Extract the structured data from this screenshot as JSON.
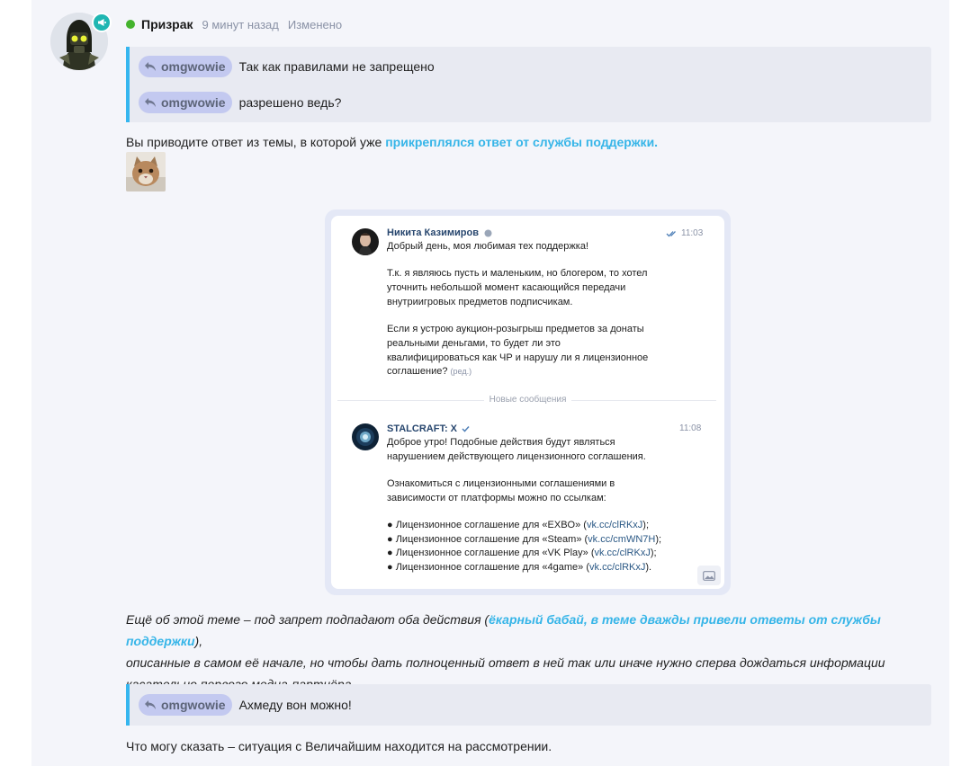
{
  "post": {
    "author": "Призрак",
    "time": "9 минут назад",
    "edited": "Изменено"
  },
  "quotes": [
    {
      "user": "omgwowie",
      "text": "Так как правилами не запрещено"
    },
    {
      "user": "omgwowie",
      "text": "разрешено ведь?"
    },
    {
      "user": "omgwowie",
      "text": "Ахмеду вон можно!"
    }
  ],
  "para1": {
    "before": "Вы приводите ответ из темы, в которой уже ",
    "link": "прикреплялся ответ от службы поддержки."
  },
  "screenshot": {
    "msg1": {
      "name": "Никита Казимиров",
      "time": "11:03",
      "lines": [
        "Добрый день, моя любимая тех поддержка!",
        "Т.к. я являюсь пусть и маленьким, но блогером, то хотел",
        "уточнить небольшой момент касающийся передачи",
        "внутриигровых предметов подписчикам.",
        "Если я устрою аукцион-розыгрыш предметов за донаты",
        "реальными деньгами, то будет ли это",
        "квалифицироваться как ЧР и нарушу ли я лицензионное",
        "соглашение?"
      ],
      "edited_mark": "(ред.)"
    },
    "divider": "Новые сообщения",
    "msg2": {
      "name": "STALCRAFT: X",
      "time": "11:08",
      "lines": [
        "Доброе утро! Подобные действия будут являться",
        "нарушением действующего лицензионного соглашения.",
        "Ознакомиться с лицензионными соглашениями в",
        "зависимости от платформы можно по ссылкам:"
      ],
      "bullets": [
        {
          "text": "● Лицензионное соглашение для «EXBO» (",
          "link": "vk.cc/clRKxJ",
          "end": ");"
        },
        {
          "text": "● Лицензионное соглашение для «Steam» (",
          "link": "vk.cc/cmWN7H",
          "end": ");"
        },
        {
          "text": "● Лицензионное соглашение для «VK Play» (",
          "link": "vk.cc/clRKxJ",
          "end": ");"
        },
        {
          "text": "● Лицензионное соглашение для «4game» (",
          "link": "vk.cc/clRKxJ",
          "end": ")."
        }
      ]
    }
  },
  "para2": {
    "before": "Ещё об этой теме – под запрет подпадают оба действия (",
    "link": "ёкарный бабай, в теме дважды привели ответы от службы поддержки",
    "after": "),",
    "line2": "описанные в самом её начале, но чтобы дать полноценный ответ в ней так или иначе нужно сперва дождаться информации",
    "line3": "касательно первого медиа-партнёра."
  },
  "para3": "Что могу сказать – ситуация с Величайшим находится на рассмотрении.",
  "colors": {
    "accent": "#35b6ef",
    "link": "#36b5e8",
    "online": "#44b32d",
    "mention_bg": "#c3c9f0",
    "quote_bg": "#e8eaf2"
  }
}
